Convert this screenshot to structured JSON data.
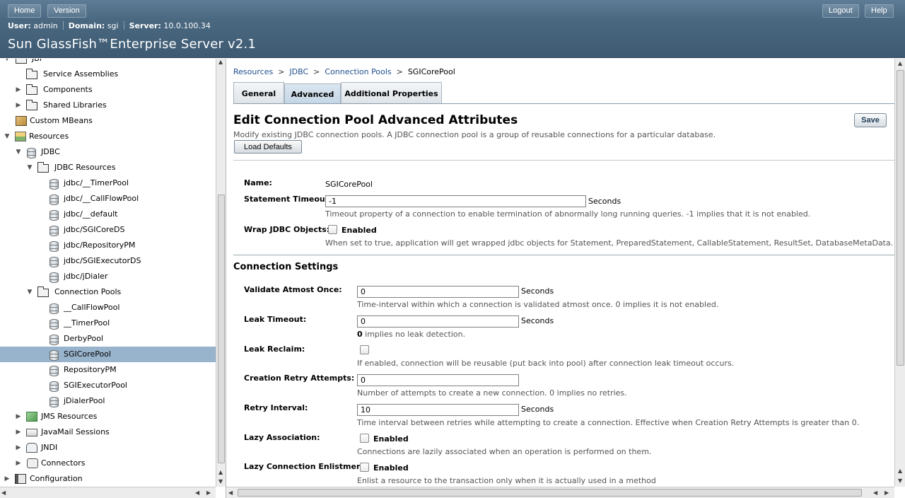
{
  "header": {
    "home_label": "Home",
    "version_label": "Version",
    "logout_label": "Logout",
    "help_label": "Help",
    "user_key": "User:",
    "user_val": "admin",
    "domain_key": "Domain:",
    "domain_val": "sgi",
    "server_key": "Server:",
    "server_val": "10.0.100.34",
    "brand": "Sun GlassFish™Enterprise Server v2.1"
  },
  "tree": {
    "items": [
      {
        "label": "JBI",
        "icon": "jbi-icon"
      },
      {
        "label": "Service Assemblies",
        "icon": "folder-icon"
      },
      {
        "label": "Components",
        "icon": "folder-icon"
      },
      {
        "label": "Shared Libraries",
        "icon": "folder-icon"
      },
      {
        "label": "Custom MBeans",
        "icon": "mbean-icon"
      },
      {
        "label": "Resources",
        "icon": "resources-icon"
      },
      {
        "label": "JDBC",
        "icon": "database-icon"
      },
      {
        "label": "JDBC Resources",
        "icon": "folder-icon"
      },
      {
        "label": "jdbc/__TimerPool",
        "icon": "database-icon"
      },
      {
        "label": "jdbc/__CallFlowPool",
        "icon": "database-icon"
      },
      {
        "label": "jdbc/__default",
        "icon": "database-icon"
      },
      {
        "label": "jdbc/SGICoreDS",
        "icon": "database-icon"
      },
      {
        "label": "jdbc/RepositoryPM",
        "icon": "database-icon"
      },
      {
        "label": "jdbc/SGIExecutorDS",
        "icon": "database-icon"
      },
      {
        "label": "jdbc/jDialer",
        "icon": "database-icon"
      },
      {
        "label": "Connection Pools",
        "icon": "folder-icon"
      },
      {
        "label": "__CallFlowPool",
        "icon": "database-icon"
      },
      {
        "label": "__TimerPool",
        "icon": "database-icon"
      },
      {
        "label": "DerbyPool",
        "icon": "database-icon"
      },
      {
        "label": "SGICorePool",
        "icon": "database-icon"
      },
      {
        "label": "RepositoryPM",
        "icon": "database-icon"
      },
      {
        "label": "SGIExecutorPool",
        "icon": "database-icon"
      },
      {
        "label": "jDialerPool",
        "icon": "database-icon"
      },
      {
        "label": "JMS Resources",
        "icon": "jms-icon"
      },
      {
        "label": "JavaMail Sessions",
        "icon": "mail-icon"
      },
      {
        "label": "JNDI",
        "icon": "jndi-icon"
      },
      {
        "label": "Connectors",
        "icon": "connector-icon"
      },
      {
        "label": "Configuration",
        "icon": "configuration-icon"
      }
    ]
  },
  "breadcrumb": {
    "resources": "Resources",
    "jdbc": "JDBC",
    "pools": "Connection Pools",
    "current": "SGICorePool",
    "sep": ">"
  },
  "tabs": {
    "general": "General",
    "advanced": "Advanced",
    "additional": "Additional Properties"
  },
  "page": {
    "title": "Edit Connection Pool Advanced Attributes",
    "description": "Modify existing JDBC connection pools. A JDBC connection pool is a group of reusable connections for a particular database.",
    "save_label": "Save",
    "load_defaults_label": "Load Defaults"
  },
  "form": {
    "name_label": "Name:",
    "name_value": "SGICorePool",
    "stmt_timeout_label": "Statement Timeout:",
    "stmt_timeout_value": "-1",
    "stmt_timeout_unit": "Seconds",
    "stmt_timeout_help": "Timeout property of a connection to enable termination of abnormally long running queries. -1 implies that it is not enabled.",
    "wrap_label": "Wrap JDBC Objects:",
    "wrap_check": "Enabled",
    "wrap_help": "When set to true, application will get wrapped jdbc objects for Statement, PreparedStatement, CallableStatement, ResultSet, DatabaseMetaData."
  },
  "connection_settings": {
    "heading": "Connection Settings",
    "validate_label": "Validate Atmost Once:",
    "validate_value": "0",
    "validate_unit": "Seconds",
    "validate_help": "Time-interval within which a connection is validated atmost once. 0 implies it is not enabled.",
    "leak_timeout_label": "Leak Timeout:",
    "leak_timeout_value": "0",
    "leak_timeout_unit": "Seconds",
    "leak_timeout_help_bold": "0",
    "leak_timeout_help": " implies no leak detection.",
    "leak_reclaim_label": "Leak Reclaim:",
    "leak_reclaim_help": "If enabled, connection will be reusable (put back into pool) after connection leak timeout occurs.",
    "retry_attempts_label": "Creation Retry Attempts:",
    "retry_attempts_value": "0",
    "retry_attempts_help": "Number of attempts to create a new connection. 0 implies no retries.",
    "retry_interval_label": "Retry Interval:",
    "retry_interval_value": "10",
    "retry_interval_unit": "Seconds",
    "retry_interval_help": "Time interval between retries while attempting to create a connection. Effective when Creation Retry Attempts is greater than 0.",
    "lazy_assoc_label": "Lazy Association:",
    "lazy_assoc_check": "Enabled",
    "lazy_assoc_help": "Connections are lazily associated when an operation is performed on them.",
    "lazy_enlist_label": "Lazy Connection Enlistment:",
    "lazy_enlist_check": "Enabled",
    "lazy_enlist_help": "Enlist a resource to the transaction only when it is actually used in a method"
  }
}
